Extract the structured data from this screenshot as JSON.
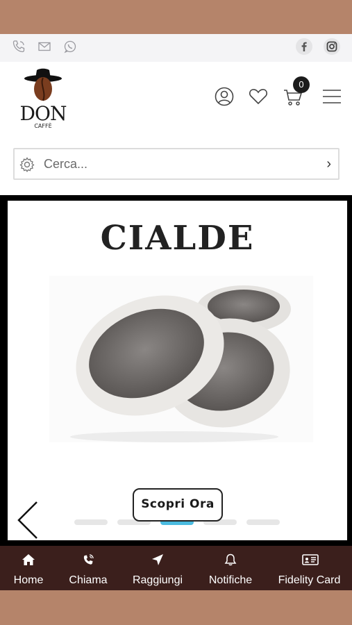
{
  "contact": {
    "icons": [
      "phone-icon",
      "mail-icon",
      "whatsapp-icon"
    ],
    "social": [
      "facebook-icon",
      "instagram-icon"
    ]
  },
  "brand": {
    "name": "DON",
    "tagline": "CAFFÈ"
  },
  "header": {
    "cart_count": "0",
    "icons": [
      "user-icon",
      "heart-icon",
      "cart-icon",
      "menu-icon"
    ]
  },
  "search": {
    "placeholder": "Cerca...",
    "go_glyph": "›"
  },
  "slider": {
    "title": "CIALDE",
    "cta_label": "Scopri Ora",
    "dots_total": 5,
    "dot_active": 2
  },
  "nav": {
    "items": [
      {
        "label": "Home",
        "icon": "home-icon"
      },
      {
        "label": "Chiama",
        "icon": "phone-ring-icon"
      },
      {
        "label": "Raggiungi",
        "icon": "location-arrow-icon"
      },
      {
        "label": "Notifiche",
        "icon": "bell-icon"
      },
      {
        "label": "Fidelity Card",
        "icon": "id-card-icon"
      }
    ]
  },
  "colors": {
    "band": "#b5846a",
    "nav_bg": "#3b1f1c",
    "accent": "#4bbbe0"
  }
}
